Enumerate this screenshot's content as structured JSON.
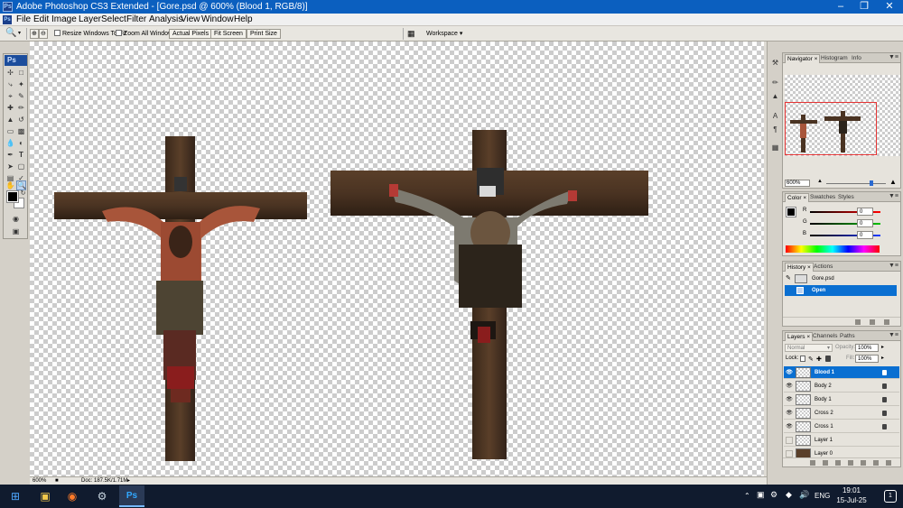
{
  "window": {
    "title": "Adobe Photoshop CS3 Extended - [Gore.psd @ 600% (Blood 1, RGB/8)]",
    "icon": "ps-app-icon",
    "controls": [
      "minimize",
      "restore",
      "close"
    ]
  },
  "menu": {
    "items": [
      "File",
      "Edit",
      "Image",
      "Layer",
      "Select",
      "Filter",
      "Analysis",
      "View",
      "Window",
      "Help"
    ]
  },
  "options_bar": {
    "resize_windows": "Resize Windows To Fit",
    "zoom_all_windows": "Zoom All Windows",
    "actual_pixels": "Actual Pixels",
    "fit_screen": "Fit Screen",
    "print_size": "Print Size",
    "workspace": "Workspace"
  },
  "toolbox": {
    "logo": "Ps",
    "tools": [
      "move",
      "marquee",
      "lasso",
      "quick-select",
      "crop",
      "slice",
      "healing",
      "brush",
      "clone-stamp",
      "history-brush",
      "eraser",
      "gradient",
      "blur",
      "dodge",
      "pen",
      "type",
      "path-select",
      "shape",
      "notes",
      "eyedropper",
      "hand",
      "zoom"
    ],
    "active_tool": "zoom",
    "foreground": "#000000",
    "background": "#ffffff"
  },
  "document": {
    "zoom": "600%",
    "doc_size": "Doc: 187.5K/1.71M"
  },
  "navigator": {
    "tabs": [
      "Navigator",
      "Histogram",
      "Info"
    ],
    "zoom": "600%"
  },
  "color_panel": {
    "tabs": [
      "Color",
      "Swatches",
      "Styles"
    ],
    "channels": [
      {
        "label": "R",
        "value": "0"
      },
      {
        "label": "G",
        "value": "0"
      },
      {
        "label": "B",
        "value": "0"
      }
    ]
  },
  "history_panel": {
    "tabs": [
      "History",
      "Actions"
    ],
    "snapshot": "Gore.psd",
    "states": [
      "Open"
    ]
  },
  "layers_panel": {
    "tabs": [
      "Layers",
      "Channels",
      "Paths"
    ],
    "blend_mode": "Normal",
    "opacity_label": "Opacity:",
    "opacity": "100%",
    "lock_label": "Lock:",
    "fill_label": "Fill:",
    "fill": "100%",
    "layers": [
      {
        "name": "Blood 1",
        "visible": true,
        "locked": true,
        "selected": true
      },
      {
        "name": "Body 2",
        "visible": true,
        "locked": true,
        "selected": false
      },
      {
        "name": "Body 1",
        "visible": true,
        "locked": true,
        "selected": false
      },
      {
        "name": "Cross 2",
        "visible": true,
        "locked": true,
        "selected": false
      },
      {
        "name": "Cross 1",
        "visible": true,
        "locked": true,
        "selected": false
      },
      {
        "name": "Layer 1",
        "visible": false,
        "locked": false,
        "selected": false
      },
      {
        "name": "Layer 0",
        "visible": false,
        "locked": false,
        "selected": false
      }
    ]
  },
  "taskbar": {
    "time": "19:01",
    "date": "15-Jul-25",
    "language": "ENG",
    "notification_count": "1",
    "apps": [
      "windows-start",
      "file-explorer",
      "firefox",
      "steam",
      "photoshop"
    ]
  },
  "colors": {
    "title_bar": "#0b5fbf",
    "selection": "#0a6fd1",
    "wood": "#4a3322",
    "wood_dark": "#2e1f14",
    "skin": "#a8553a",
    "blood": "#8a1d1d",
    "cloth": "#4d4433",
    "taskbar": "#101b2e"
  }
}
